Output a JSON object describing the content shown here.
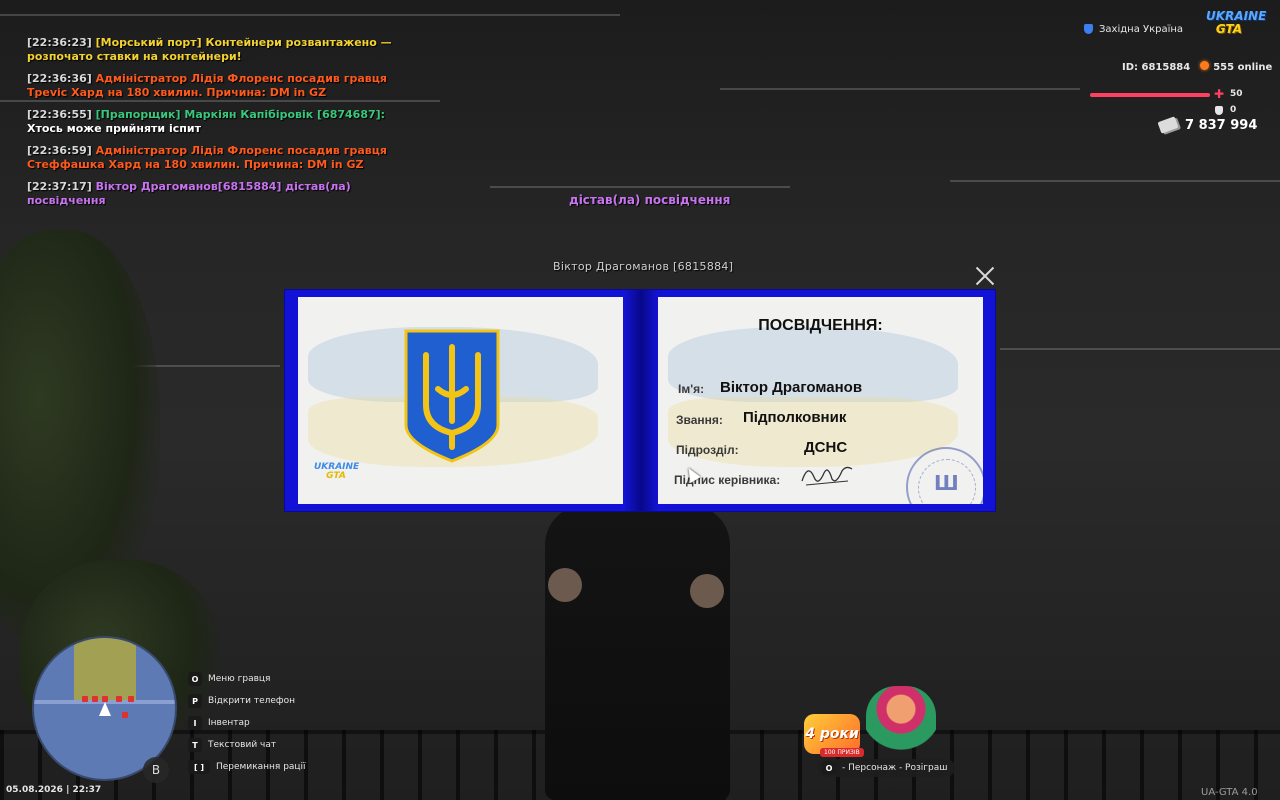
{
  "chat": [
    {
      "time": "[22:36:23]",
      "text": "[Морський порт] Контейнери розвантажено — розпочато ставки на контейнери!",
      "color": "yellow"
    },
    {
      "time": "[22:36:36]",
      "text": "Адміністратор Лідія Флоренс посадив гравця Трevіс Хард на 180 хвилин. Причина: DM in GZ",
      "color": "orange"
    },
    {
      "time": "[22:36:55]",
      "prefix": "[Прапорщик] Маркіян Капібіровік [6874687]:",
      "text": "Хтось може прийняти іспит",
      "color": "green"
    },
    {
      "time": "[22:36:59]",
      "text": "Адміністратор Лідія Флоренс посадив гравця Стеффашка Хард на 180 хвилин. Причина: DM in GZ",
      "color": "orange"
    },
    {
      "time": "[22:37:17]",
      "text": "Віктор Драгоманов[6815884] дістав(ла) посвідчення",
      "color": "purple"
    }
  ],
  "action_text": "дістав(ла) посвідчення",
  "player_nametag": "Віктор Драгоманов [6815884]",
  "hud": {
    "region": "Західна Україна",
    "logo_line1": "UKRAINE",
    "logo_line2": "GTA",
    "id_label": "ID: 6815884",
    "online": "555 online",
    "health": "50",
    "health_fraction": 0.5,
    "armor": "0",
    "money": "7 837 994"
  },
  "id_card": {
    "title": "ПОСВІДЧЕННЯ:",
    "name_label": "Ім'я:",
    "name_value": "Віктор Драгоманов",
    "rank_label": "Звання:",
    "rank_value": "Підполковник",
    "unit_label": "Підрозділ:",
    "unit_value": "ДСНС",
    "signature_label": "Підпис керівника:",
    "mini_logo_line1": "UKRAINE",
    "mini_logo_line2": "GTA"
  },
  "hints": [
    {
      "key": "O",
      "label": "Меню гравця"
    },
    {
      "key": "P",
      "label": "Відкрити телефон"
    },
    {
      "key": "I",
      "label": "Інвентар"
    },
    {
      "key": "T",
      "label": "Текстовий чат"
    },
    {
      "key": "[  ]",
      "label": "Перемикання рації"
    }
  ],
  "datetime": "05.08.2026 | 22:37",
  "mic_key": "B",
  "promo": {
    "badge": "4 роки",
    "sub": "100 ПРИЗІВ",
    "bar_key": "O",
    "bar_text": "- Персонаж - Розіграш"
  },
  "watermark": "UA-GTA 4.0",
  "colors": {
    "card_frame": "#1212d6",
    "chat_yellow": "#f3d232",
    "chat_orange": "#ff5a1e",
    "chat_green": "#39c77b",
    "chat_purple": "#c873f0",
    "health": "#ff4060"
  },
  "icons": [
    "close-icon",
    "shield-icon",
    "heart-icon",
    "armor-icon",
    "money-icon",
    "mic-icon",
    "trident-icon"
  ]
}
